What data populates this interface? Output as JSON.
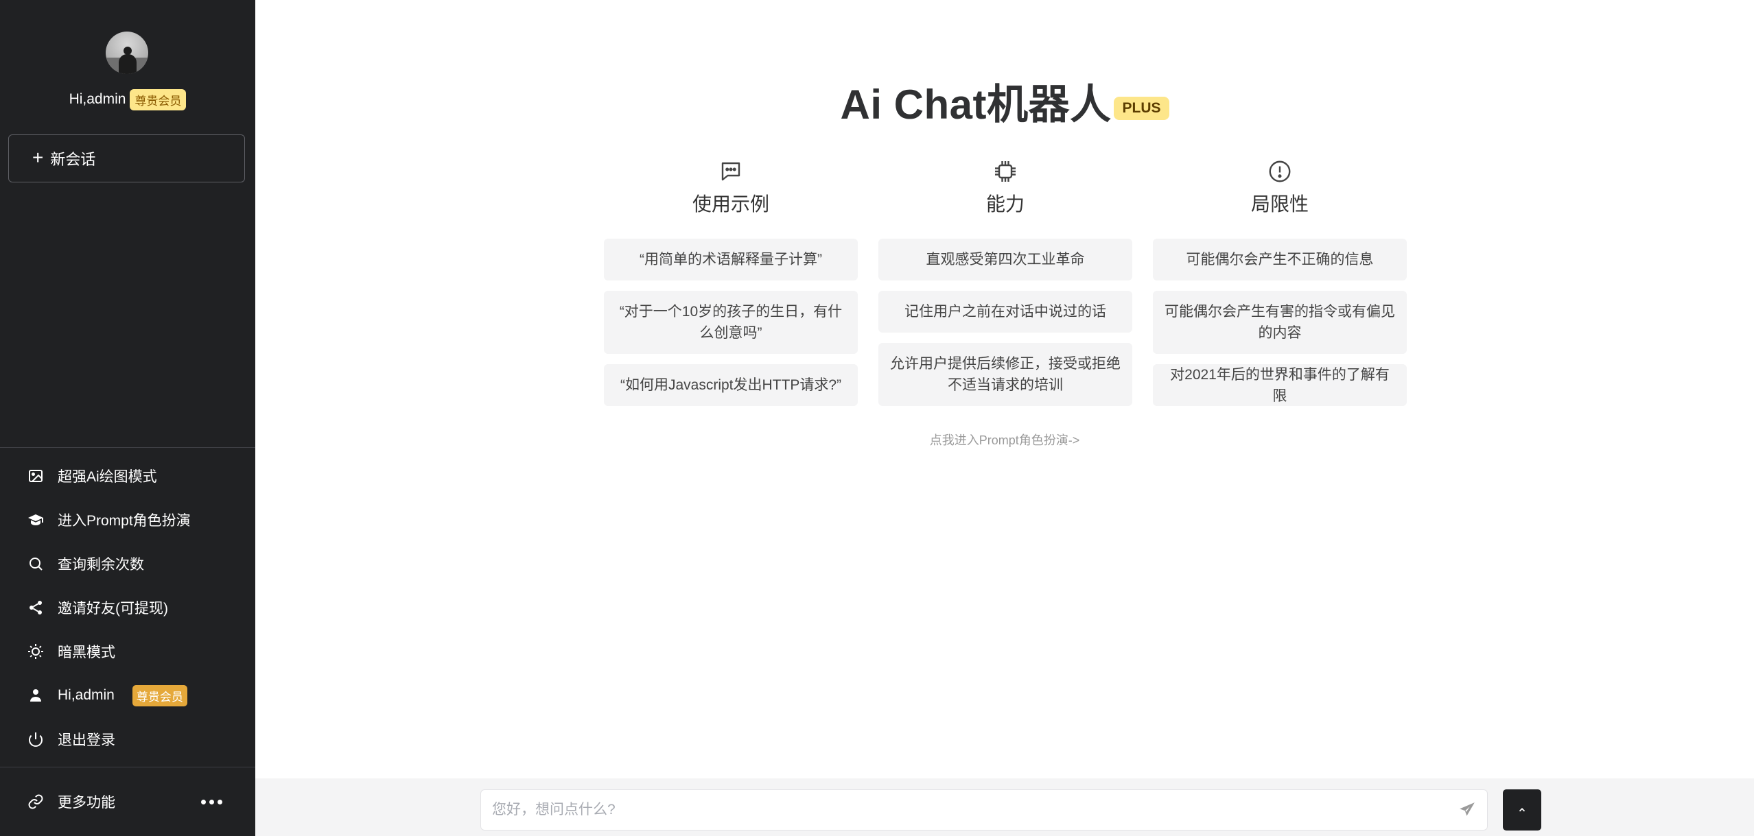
{
  "sidebar": {
    "username": "Hi,admin",
    "vip_label": "尊贵会员",
    "new_chat_label": "新会话",
    "menu": [
      {
        "label": "超强Ai绘图模式",
        "icon": "image-icon"
      },
      {
        "label": "进入Prompt角色扮演",
        "icon": "graduation-cap-icon"
      },
      {
        "label": "查询剩余次数",
        "icon": "search-icon"
      },
      {
        "label": "邀请好友(可提现)",
        "icon": "share-icon"
      },
      {
        "label": "暗黑模式",
        "icon": "sun-icon"
      },
      {
        "label": "Hi,admin",
        "icon": "user-icon",
        "badge": "尊贵会员"
      },
      {
        "label": "退出登录",
        "icon": "power-icon"
      }
    ],
    "more_label": "更多功能"
  },
  "main": {
    "title": "Ai Chat机器人",
    "badge": "PLUS",
    "columns": [
      {
        "icon": "chat-icon",
        "title": "使用示例",
        "items": [
          "“用简单的术语解释量子计算”",
          "“对于一个10岁的孩子的生日，有什么创意吗”",
          "“如何用Javascript发出HTTP请求?”"
        ]
      },
      {
        "icon": "cpu-icon",
        "title": "能力",
        "items": [
          "直观感受第四次工业革命",
          "记住用户之前在对话中说过的话",
          "允许用户提供后续修正，接受或拒绝不适当请求的培训"
        ]
      },
      {
        "icon": "alert-icon",
        "title": "局限性",
        "items": [
          "可能偶尔会产生不正确的信息",
          "可能偶尔会产生有害的指令或有偏见的内容",
          "对2021年后的世界和事件的了解有限"
        ]
      }
    ],
    "prompt_link": "点我进入Prompt角色扮演->"
  },
  "input": {
    "placeholder": "您好，想问点什么?",
    "value": ""
  },
  "colors": {
    "sidebar_bg": "#202123",
    "vip_badge": "#e5a83a",
    "plus_badge": "#fde68a"
  }
}
